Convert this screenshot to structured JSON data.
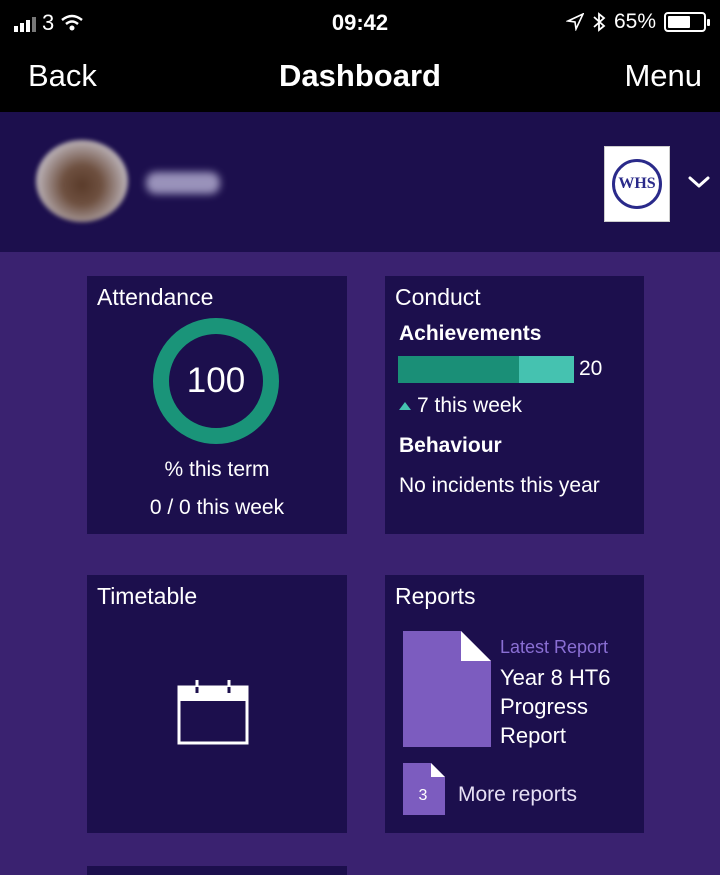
{
  "status_bar": {
    "carrier": "3",
    "time": "09:42",
    "battery_percent": "65%",
    "battery_level": 0.65
  },
  "nav": {
    "back_label": "Back",
    "title": "Dashboard",
    "menu_label": "Menu"
  },
  "profile": {
    "school_logo_text": "WHS"
  },
  "attendance": {
    "title": "Attendance",
    "value": "100",
    "term_label": "% this term",
    "week_label": "0 / 0 this week",
    "percent": 100
  },
  "conduct": {
    "title": "Conduct",
    "achievements_heading": "Achievements",
    "achievements_count": "20",
    "achievements_total": 20,
    "achievements_this_week": 7,
    "week_change": "7 this week",
    "behaviour_heading": "Behaviour",
    "behaviour_text": "No incidents this year"
  },
  "timetable": {
    "title": "Timetable"
  },
  "reports": {
    "title": "Reports",
    "latest_label": "Latest Report",
    "latest_name": "Year 8 HT6 Progress Report",
    "more_count": "3",
    "more_label": "More reports"
  },
  "colors": {
    "background": "#3a2270",
    "card": "#1c0f4d",
    "accent_green": "#1a8f77",
    "accent_teal": "#45c2b0",
    "report_purple": "#8a6fd4"
  },
  "icons": {
    "wifi": "wifi-icon",
    "location": "location-arrow-icon",
    "bluetooth": "bluetooth-icon",
    "calendar": "calendar-icon",
    "document": "document-icon",
    "chevron": "chevron-down-icon"
  }
}
